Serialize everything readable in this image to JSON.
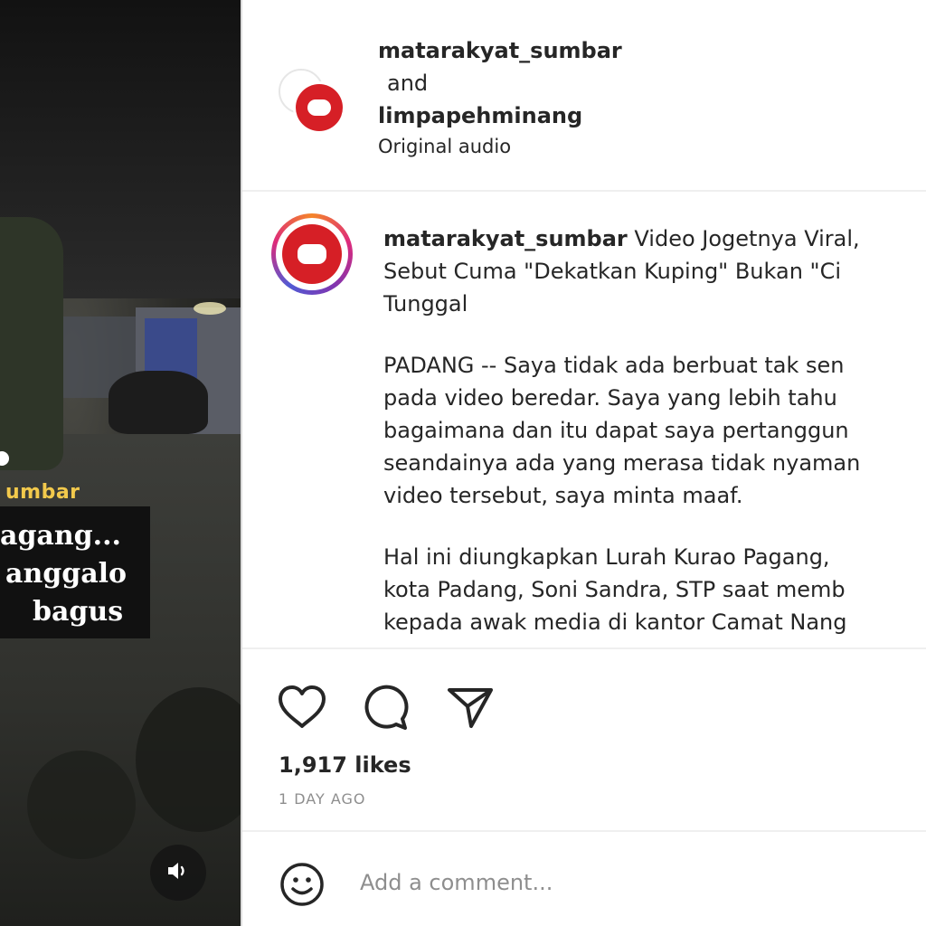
{
  "video": {
    "overlay_username": "umbar",
    "caption_lines": [
      "agang...",
      "anggalo",
      "bagus"
    ],
    "sound_icon": "speaker-icon"
  },
  "header": {
    "account_primary": "matarakyat_sumbar",
    "joiner": "and",
    "account_secondary": "limpapehminang",
    "audio": "Original audio"
  },
  "post": {
    "username": "matarakyat_sumbar",
    "title_lines": [
      "Video Jogetnya Viral,",
      "Sebut Cuma \"Dekatkan Kuping\" Bukan \"Ci",
      "Tunggal"
    ],
    "paragraph1": [
      "PADANG -- Saya tidak ada berbuat tak sen",
      "pada video beredar. Saya yang lebih tahu",
      "bagaimana dan itu dapat saya pertanggun",
      "seandainya ada yang merasa tidak nyaman",
      "video tersebut, saya minta maaf."
    ],
    "paragraph2": [
      "Hal ini diungkapkan Lurah Kurao Pagang,",
      "kota Padang, Soni Sandra, STP saat memb",
      "kepada awak media di kantor Camat Nang"
    ]
  },
  "actions": {
    "like_icon": "heart-icon",
    "comment_icon": "comment-icon",
    "share_icon": "send-icon",
    "likes": "1,917 likes",
    "timestamp": "1 DAY AGO"
  },
  "comment_bar": {
    "emoji_icon": "emoji-icon",
    "placeholder": "Add a comment..."
  },
  "colors": {
    "brand_red": "#d61f26",
    "overlay_yellow": "#f2c94c",
    "text": "#262626",
    "muted": "#8e8e8e"
  }
}
